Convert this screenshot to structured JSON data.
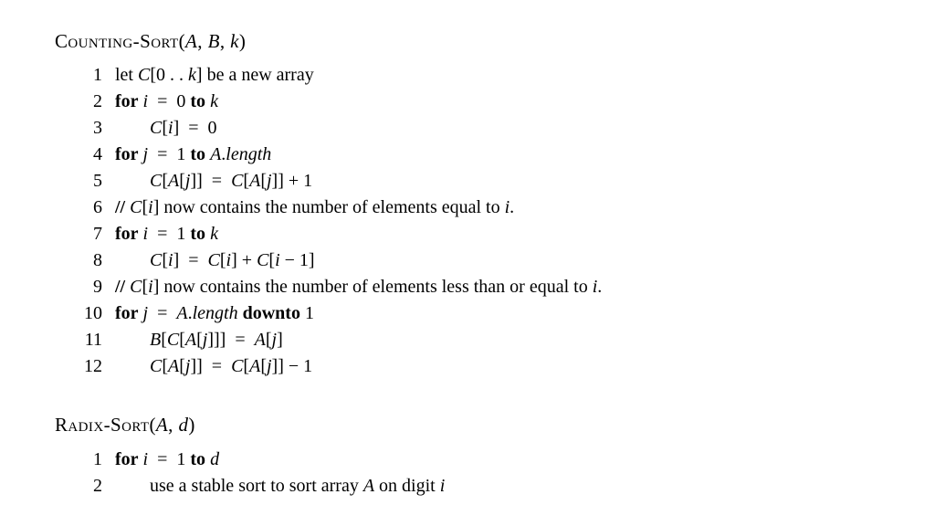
{
  "algo1": {
    "name": "Counting-Sort",
    "params": "(A, B, k)",
    "lines": [
      {
        "n": "1",
        "html": "let <span class='it'>C</span>[0 . . <span class='it'>k</span>] be a new array"
      },
      {
        "n": "2",
        "html": "<span class='kw'>for</span> <span class='it'>i</span>  =  0 <span class='kw'>to</span> <span class='it'>k</span>"
      },
      {
        "n": "3",
        "indent": 1,
        "html": "<span class='it'>C</span>[<span class='it'>i</span>]  =  0"
      },
      {
        "n": "4",
        "html": "<span class='kw'>for</span> <span class='it'>j</span>  =  1 <span class='kw'>to</span> <span class='it'>A</span>.<span class='it'>length</span>"
      },
      {
        "n": "5",
        "indent": 1,
        "html": "<span class='it'>C</span>[<span class='it'>A</span>[<span class='it'>j</span>]]  =  <span class='it'>C</span>[<span class='it'>A</span>[<span class='it'>j</span>]] + 1"
      },
      {
        "n": "6",
        "html": "<span class='sl'>//</span> <span class='cm'><span class='it'>C</span>[<span class='it'>i</span>] now contains the number of elements equal to <span class='it'>i</span>.</span>"
      },
      {
        "n": "7",
        "html": "<span class='kw'>for</span> <span class='it'>i</span>  =  1 <span class='kw'>to</span> <span class='it'>k</span>"
      },
      {
        "n": "8",
        "indent": 1,
        "html": "<span class='it'>C</span>[<span class='it'>i</span>]  =  <span class='it'>C</span>[<span class='it'>i</span>] + <span class='it'>C</span>[<span class='it'>i</span> − 1]"
      },
      {
        "n": "9",
        "html": "<span class='sl'>//</span> <span class='cm'><span class='it'>C</span>[<span class='it'>i</span>] now contains the number of elements less than or equal to <span class='it'>i</span>.</span>"
      },
      {
        "n": "10",
        "html": "<span class='kw'>for</span> <span class='it'>j</span>  =  <span class='it'>A</span>.<span class='it'>length</span> <span class='kw'>downto</span> 1"
      },
      {
        "n": "11",
        "indent": 1,
        "html": "<span class='it'>B</span>[<span class='it'>C</span>[<span class='it'>A</span>[<span class='it'>j</span>]]]  =  <span class='it'>A</span>[<span class='it'>j</span>]"
      },
      {
        "n": "12",
        "indent": 1,
        "html": "<span class='it'>C</span>[<span class='it'>A</span>[<span class='it'>j</span>]]  =  <span class='it'>C</span>[<span class='it'>A</span>[<span class='it'>j</span>]] − 1"
      }
    ]
  },
  "algo2": {
    "name": "Radix-Sort",
    "params": "(A, d)",
    "lines": [
      {
        "n": "1",
        "html": "<span class='kw'>for</span> <span class='it'>i</span>  =  1 <span class='kw'>to</span> <span class='it'>d</span>"
      },
      {
        "n": "2",
        "indent": 1,
        "html": "use a stable sort to sort array <span class='it'>A</span> on digit <span class='it'>i</span>"
      }
    ]
  }
}
